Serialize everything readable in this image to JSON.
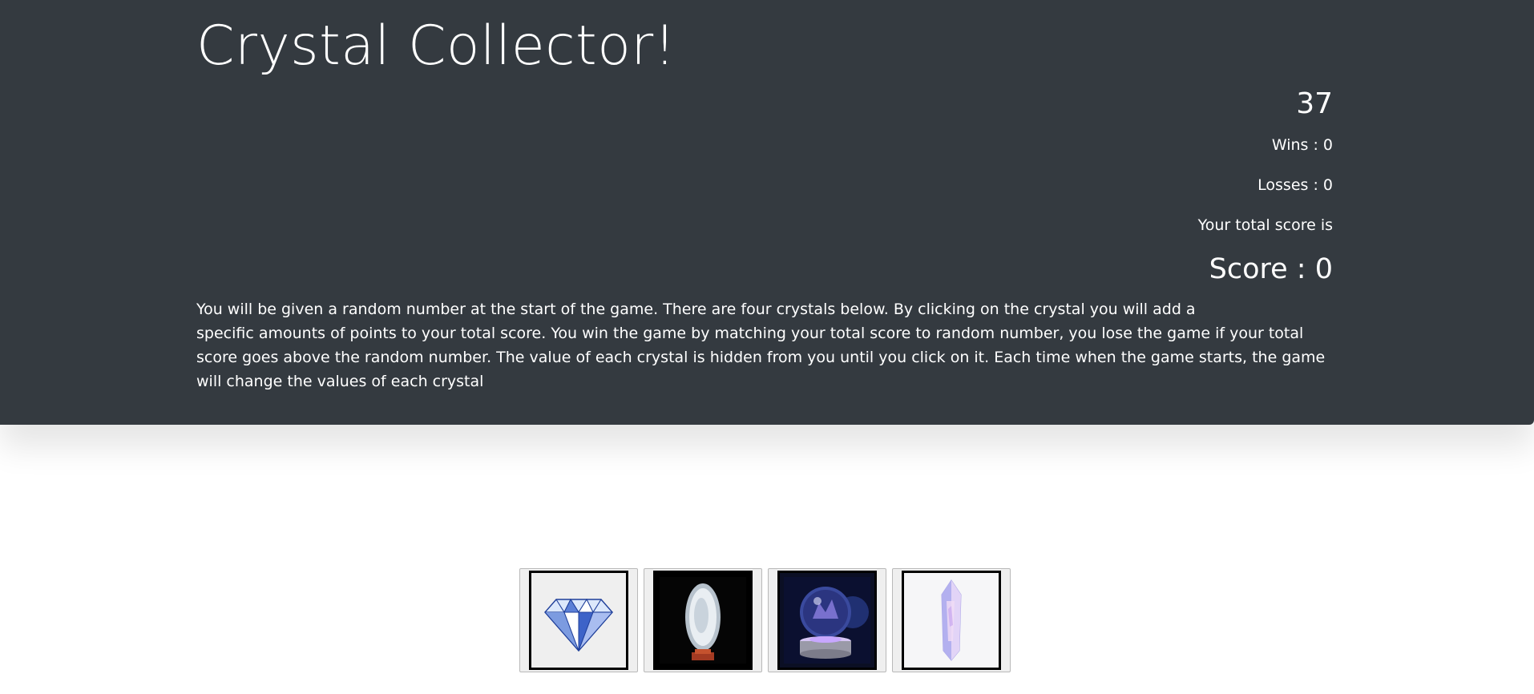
{
  "game": {
    "title": "Crystal Collector!",
    "random_number": "37",
    "wins_text": "Wins : 0",
    "losses_text": "Losses : 0",
    "total_score_label": "Your total score is",
    "score_text": "Score : 0",
    "instructions_line1": "You will be given a random number at the start of the game. There are four crystals below. By clicking on the crystal you will add a",
    "instructions_rest": "specific amounts of points to your total score. You win the game by matching your total score to random number, you lose the game if your total score goes above the random number. The value of each crystal is hidden from you until you click on it. Each time when the game starts, the game will change the values of each crystal"
  },
  "crystals": [
    {
      "icon": "diamond-icon"
    },
    {
      "icon": "geode-icon"
    },
    {
      "icon": "glass-orb-icon"
    },
    {
      "icon": "quartz-crystal-icon"
    }
  ],
  "colors": {
    "header_bg": "#343a40",
    "header_text": "#ffffff",
    "page_bg": "#ffffff"
  }
}
